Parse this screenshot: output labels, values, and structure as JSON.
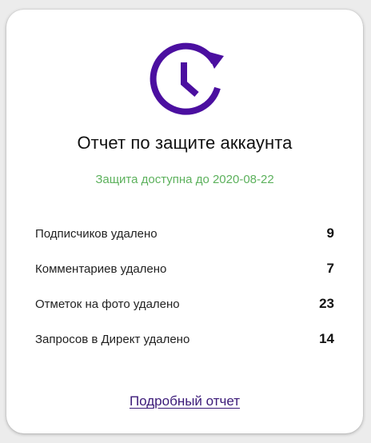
{
  "header": {
    "icon": "clock-refresh-icon",
    "title": "Отчет по защите аккаунта",
    "subtitle": "Защита доступна до 2020-08-22"
  },
  "stats": [
    {
      "label": "Подписчиков удалено",
      "value": "9"
    },
    {
      "label": "Комментариев удалено",
      "value": "7"
    },
    {
      "label": "Отметок на фото удалено",
      "value": "23"
    },
    {
      "label": "Запросов в Директ удалено",
      "value": "14"
    }
  ],
  "footer": {
    "link_label": "Подробный отчет"
  },
  "colors": {
    "accent": "#4b0fa0",
    "success": "#5cb15c",
    "link": "#3b1a78"
  }
}
